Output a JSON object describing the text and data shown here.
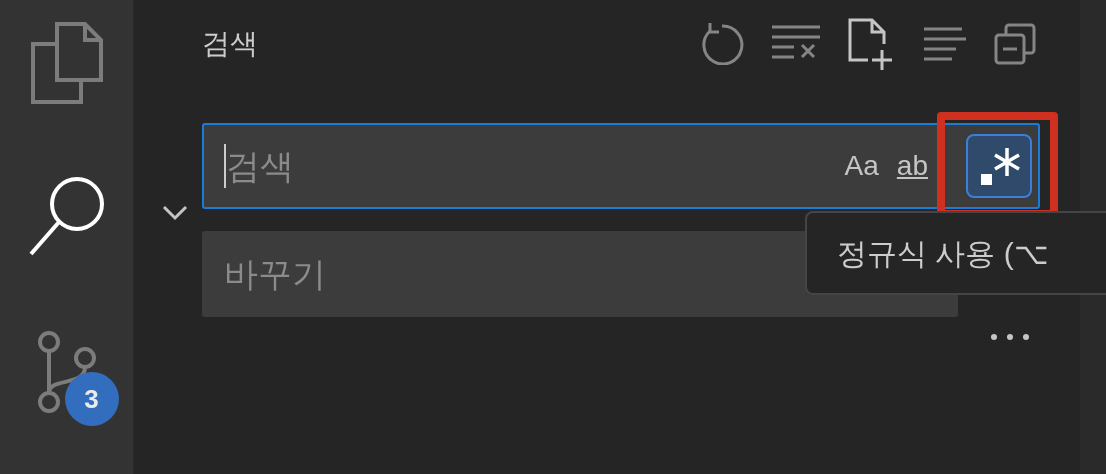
{
  "activity_bar": {
    "items": [
      {
        "kind": "files",
        "selected": false
      },
      {
        "kind": "search",
        "selected": true
      },
      {
        "kind": "source_control",
        "selected": false,
        "badge": "3"
      }
    ]
  },
  "panel": {
    "title": "검색",
    "replace_toggle": {
      "expanded": true
    },
    "search": {
      "placeholder": "검색",
      "focused": true,
      "match_case": {
        "label": "Aa",
        "selected": false
      },
      "whole_word": {
        "label": "ab",
        "selected": false
      },
      "regex": {
        "selected": true,
        "highlighted": true
      }
    },
    "replace": {
      "placeholder": "바꾸기"
    },
    "tooltip": {
      "text": "정규식 사용 (⌥"
    }
  }
}
